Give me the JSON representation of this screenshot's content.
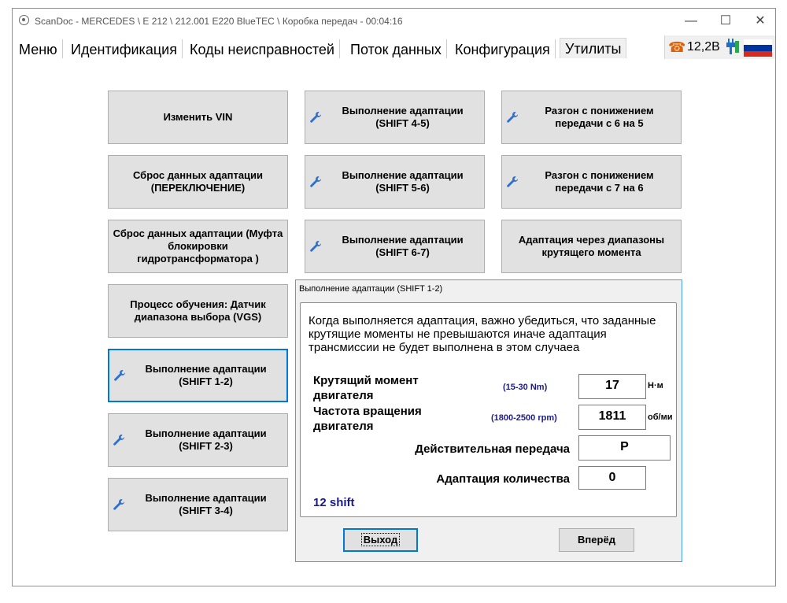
{
  "window": {
    "title": "ScanDoc - MERCEDES \\ E 212 \\ 212.001 E220 BlueTEC \\ Коробка передач - 00:04:16",
    "minimize": "—",
    "maximize": "☐",
    "close": "✕"
  },
  "menu": {
    "items": [
      "Меню",
      "Идентификация",
      "Коды неисправностей",
      "Поток данных",
      "Конфигурация",
      "Утилиты"
    ],
    "active_index": 5
  },
  "status": {
    "voltage": "12,2В",
    "phone_icon": "☎",
    "flag_colors": [
      "#ffffff",
      "#0033a0",
      "#d52b1e"
    ]
  },
  "tiles": [
    {
      "label": "Изменить VIN",
      "icon": false
    },
    {
      "label": "Выполнение адаптации (SHIFT 4-5)",
      "icon": true
    },
    {
      "label": "Разгон с понижением передачи с 6 на 5",
      "icon": true
    },
    {
      "label": "Сброс данных адаптации (ПЕРЕКЛЮЧЕНИЕ)",
      "icon": false
    },
    {
      "label": "Выполнение адаптации (SHIFT 5-6)",
      "icon": true
    },
    {
      "label": "Разгон с понижением передачи с 7 на 6",
      "icon": true
    },
    {
      "label": "Сброс данных адаптации (Муфта блокировки гидротрансформатора )",
      "icon": false
    },
    {
      "label": "Выполнение адаптации (SHIFT 6-7)",
      "icon": true
    },
    {
      "label": "Адаптация через диапазоны крутящего момента",
      "icon": false
    },
    {
      "label": "Процесс обучения: Датчик диапазона выбора (VGS)",
      "icon": false
    },
    {
      "label": "Выполнение адаптации (SHIFT 1-2)",
      "icon": true,
      "focused": true
    },
    {
      "label": "Выполнение адаптации (SHIFT 2-3)",
      "icon": true
    },
    {
      "label": "Выполнение адаптации (SHIFT 3-4)",
      "icon": true
    }
  ],
  "dialog": {
    "title": "Выполнение адаптации (SHIFT 1-2)",
    "message": "Когда выполняется адаптация, важно убедиться, что заданные крутящие моменты не превышаются иначе адаптация трансмиссии не будет выполнена в этом случаеа",
    "torque": {
      "label": "Крутящий момент двигателя",
      "range": "(15-30 Nm)",
      "value": "17",
      "unit": "Н·м"
    },
    "rpm": {
      "label": "Частота вращения двигателя",
      "range": "(1800-2500 rpm)",
      "value": "1811",
      "unit": "об/мин"
    },
    "gear": {
      "label": "Действительная передача",
      "value": "P"
    },
    "count": {
      "label": "Адаптация количества",
      "value": "0"
    },
    "shift_label": "12 shift",
    "exit_button": "Выход",
    "next_button": "Вперёд"
  }
}
